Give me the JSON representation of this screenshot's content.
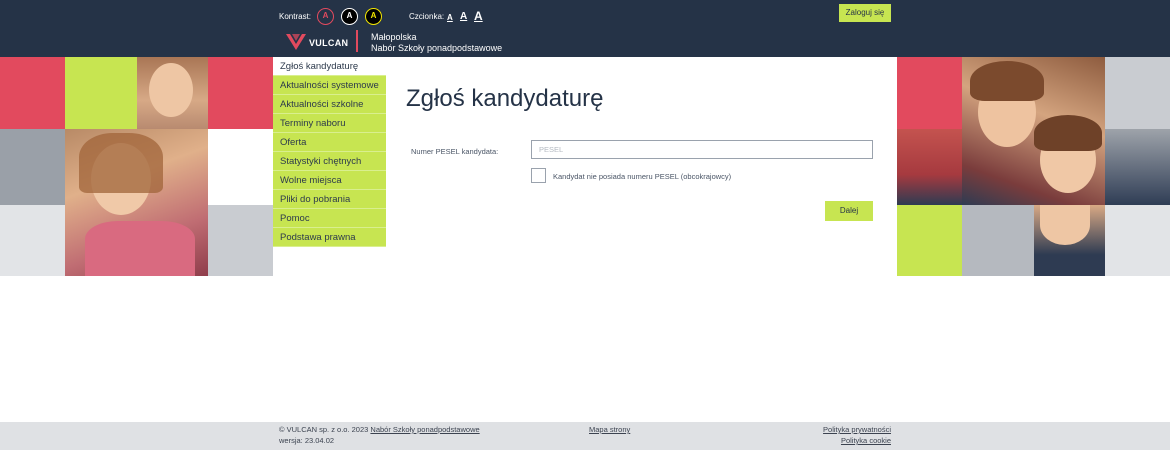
{
  "header": {
    "contrast_label": "Kontrast:",
    "contrast_buttons": [
      "A",
      "A",
      "A"
    ],
    "font_label": "Czcionka:",
    "font_sizes": [
      "A",
      "A",
      "A"
    ],
    "login_label": "Zaloguj się",
    "logo_text": "VULCAN",
    "region_line1": "Małopolska",
    "region_line2": "Nabór Szkoły ponadpodstawowe"
  },
  "nav": {
    "items": [
      {
        "label": "Zgłoś kandydaturę"
      },
      {
        "label": "Aktualności systemowe"
      },
      {
        "label": "Aktualności szkolne"
      },
      {
        "label": "Terminy naboru"
      },
      {
        "label": "Oferta"
      },
      {
        "label": "Statystyki chętnych"
      },
      {
        "label": "Wolne miejsca"
      },
      {
        "label": "Pliki do pobrania"
      },
      {
        "label": "Pomoc"
      },
      {
        "label": "Podstawa prawna"
      }
    ]
  },
  "main": {
    "title": "Zgłoś kandydaturę",
    "pesel_label": "Numer PESEL kandydata:",
    "pesel_placeholder": "PESEL",
    "pesel_value": "",
    "no_pesel_label": "Kandydat nie posiada numeru PESEL (obcokrajowcy)",
    "no_pesel_checked": false,
    "next_label": "Dalej"
  },
  "footer": {
    "copyright": "© VULCAN sp. z o.o. 2023",
    "copyright_link": "Nabór Szkoły ponadpodstawowe",
    "version": "wersja: 23.04.02",
    "sitemap": "Mapa strony",
    "privacy": "Polityka prywatności",
    "cookies": "Polityka cookie"
  },
  "colors": {
    "header_bg": "#253347",
    "accent_green": "#c7e551",
    "accent_red": "#e24a5e",
    "tile_grey": "#c9ccd1",
    "footer_bg": "#dfe1e4"
  }
}
